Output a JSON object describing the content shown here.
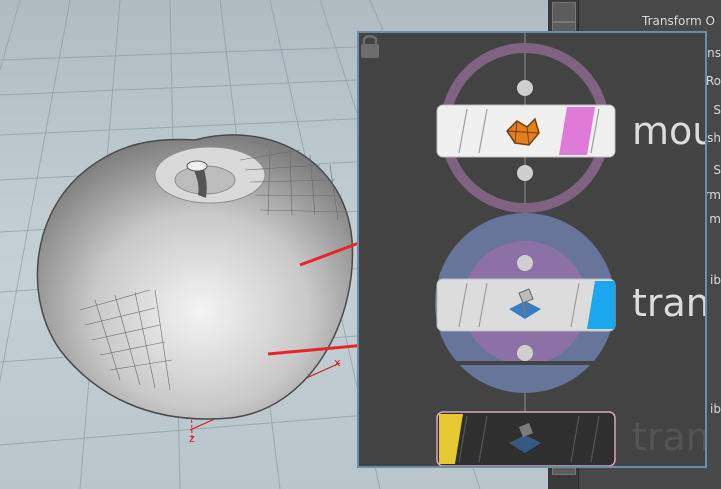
{
  "viewport": {
    "axis_x_label": "x",
    "axis_z_label": "z"
  },
  "attribute_editor": {
    "title": "Transform O",
    "rows": [
      "ns",
      "Ro",
      "S",
      "sh",
      "S",
      "rm",
      "m",
      "ib",
      "ib"
    ]
  },
  "node_editor": {
    "nodes": [
      {
        "name": "mou",
        "type_icon": "mesh-shape-icon",
        "color_tab": "#e07ad8",
        "ring_color": "#8c6b8e"
      },
      {
        "name": "trans",
        "type_icon": "transform-icon",
        "color_tab": "#1aa7ee",
        "ring_color": "#6f7fa6"
      },
      {
        "name": "trans",
        "type_icon": "transform-icon",
        "color_tab": "#e6c830",
        "ring_color": "none"
      }
    ]
  },
  "colors": {
    "accent_red": "#e8262a",
    "editor_border": "#6d8ca8",
    "panel_bg": "#434343"
  },
  "icons": [
    "lock-icon",
    "shelf-tool-icon"
  ]
}
